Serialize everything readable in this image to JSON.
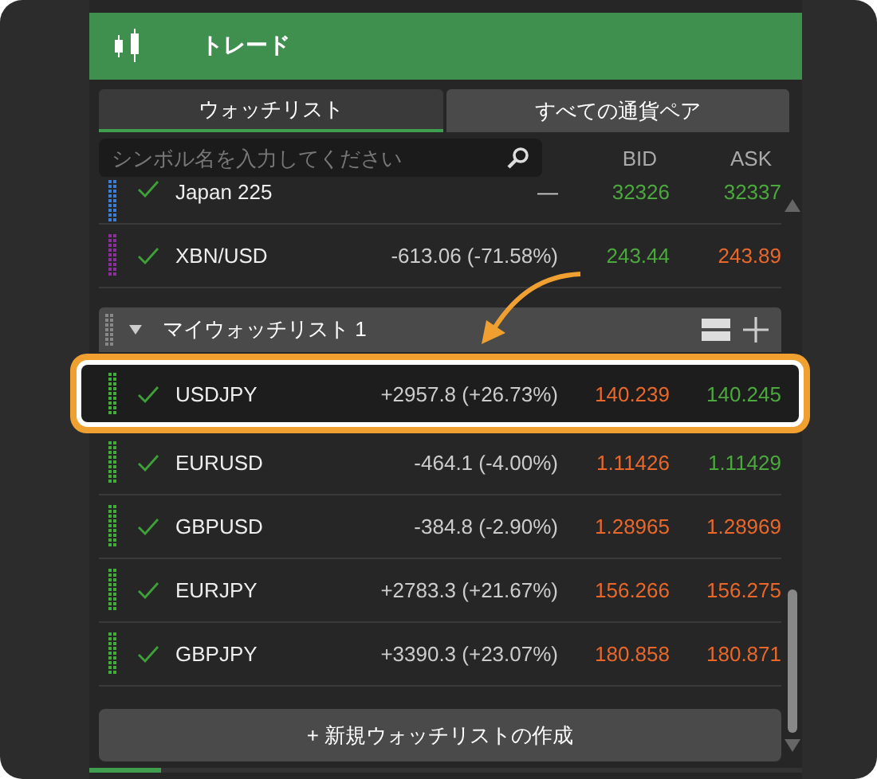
{
  "header": {
    "title": "トレード"
  },
  "tabs": [
    {
      "label": "ウォッチリスト",
      "selected": true
    },
    {
      "label": "すべての通貨ペア",
      "selected": false
    }
  ],
  "search": {
    "placeholder": "シンボル名を入力してください"
  },
  "columns": [
    "BID",
    "ASK"
  ],
  "rows": [
    {
      "kind": "row",
      "symbol": "Japan 225",
      "change": "—",
      "bid": {
        "value": "32326",
        "color": "#4aa83c"
      },
      "ask": {
        "value": "32337",
        "color": "#4aa83c"
      },
      "color": "#3a7fd5",
      "checked": true,
      "selected": false
    },
    {
      "kind": "row",
      "symbol": "XBN/USD",
      "change": "-613.06 (-71.58%)",
      "bid": {
        "value": "243.44",
        "color": "#4aa83c"
      },
      "ask": {
        "value": "243.89",
        "color": "#e8672a"
      },
      "color": "#8a2f9e",
      "checked": true,
      "selected": false
    },
    {
      "kind": "group",
      "title": "マイウォッチリスト 1",
      "expanded": true
    },
    {
      "kind": "row",
      "symbol": "USDJPY",
      "change": "+2957.8 (+26.73%)",
      "bid": {
        "value": "140.239",
        "color": "#e8672a"
      },
      "ask": {
        "value": "140.245",
        "color": "#4aa83c"
      },
      "color": "#3fae3a",
      "checked": true,
      "selected": true
    },
    {
      "kind": "row",
      "symbol": "EURUSD",
      "change": "-464.1 (-4.00%)",
      "bid": {
        "value": "1.11426",
        "color": "#e8672a"
      },
      "ask": {
        "value": "1.11429",
        "color": "#4aa83c"
      },
      "color": "#3fae3a",
      "checked": true,
      "selected": false
    },
    {
      "kind": "row",
      "symbol": "GBPUSD",
      "change": "-384.8 (-2.90%)",
      "bid": {
        "value": "1.28965",
        "color": "#e8672a"
      },
      "ask": {
        "value": "1.28969",
        "color": "#e8672a"
      },
      "color": "#3fae3a",
      "checked": true,
      "selected": false
    },
    {
      "kind": "row",
      "symbol": "EURJPY",
      "change": "+2783.3 (+21.67%)",
      "bid": {
        "value": "156.266",
        "color": "#e8672a"
      },
      "ask": {
        "value": "156.275",
        "color": "#e8672a"
      },
      "color": "#3fae3a",
      "checked": true,
      "selected": false
    },
    {
      "kind": "row",
      "symbol": "GBPJPY",
      "change": "+3390.3 (+23.07%)",
      "bid": {
        "value": "180.858",
        "color": "#e8672a"
      },
      "ask": {
        "value": "180.871",
        "color": "#e8672a"
      },
      "color": "#3fae3a",
      "checked": true,
      "selected": false
    }
  ],
  "new_button": "+ 新規ウォッチリストの作成",
  "bottom_bar": {
    "level": 0.1
  }
}
